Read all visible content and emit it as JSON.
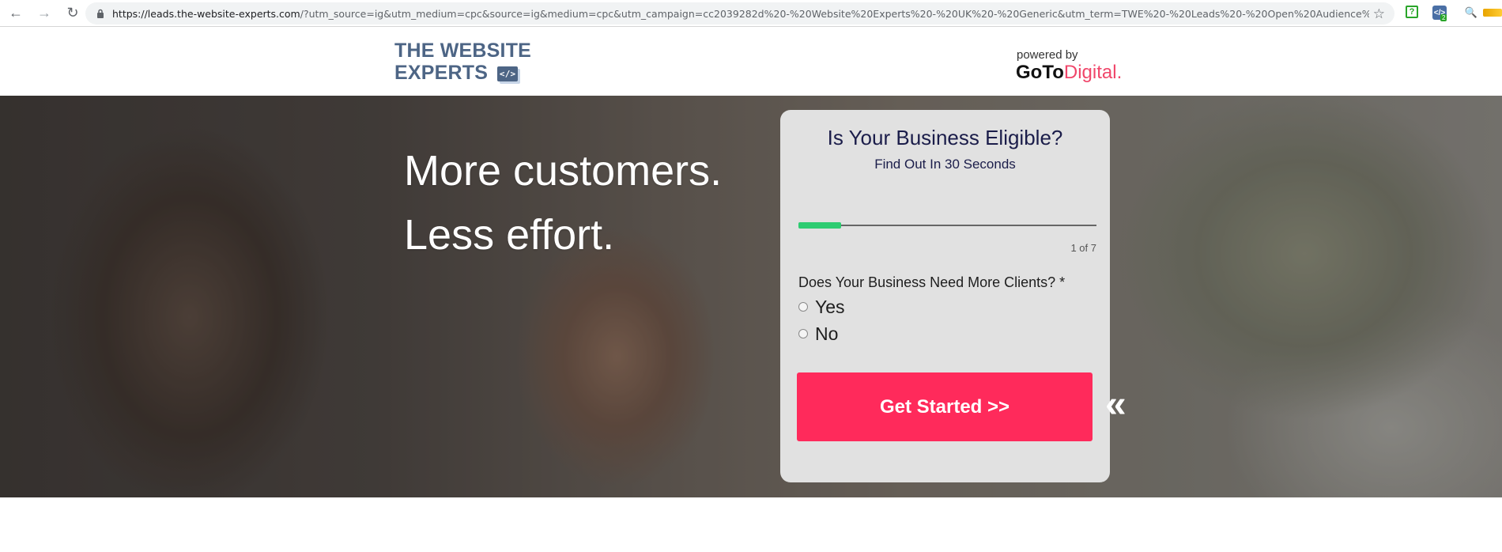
{
  "browser": {
    "url_host": "https://leads.the-website-experts.com",
    "url_path": "/?utm_source=ig&utm_medium=cpc&source=ig&medium=cpc&utm_campaign=cc2039282d%20-%20Website%20Experts%20-%20UK%20-%20Generic&utm_term=TWE%20-%20Leads%20-%20Open%20Audience%2...",
    "extension_badge": "2"
  },
  "header": {
    "brand_line1": "THE WEBSITE",
    "brand_line2": "EXPERTS",
    "brand_code": "</>",
    "powered_by": "powered by",
    "partner_goto": "GoTo",
    "partner_digital": "Digital."
  },
  "hero": {
    "headline_line1": "More customers.",
    "headline_line2": "Less effort."
  },
  "form": {
    "title": "Is Your Business Eligible?",
    "subtitle": "Find Out In 30 Seconds",
    "progress_fraction": 0.143,
    "step_text": "1 of 7",
    "question": "Does Your Business Need More Clients? *",
    "options": [
      "Yes",
      "No"
    ],
    "cta_label": "Get Started >>",
    "back_label": "«"
  },
  "colors": {
    "brand": "#4d6585",
    "cta": "#ff2a5b",
    "progress": "#2ecc71",
    "title": "#1b1d4a"
  }
}
